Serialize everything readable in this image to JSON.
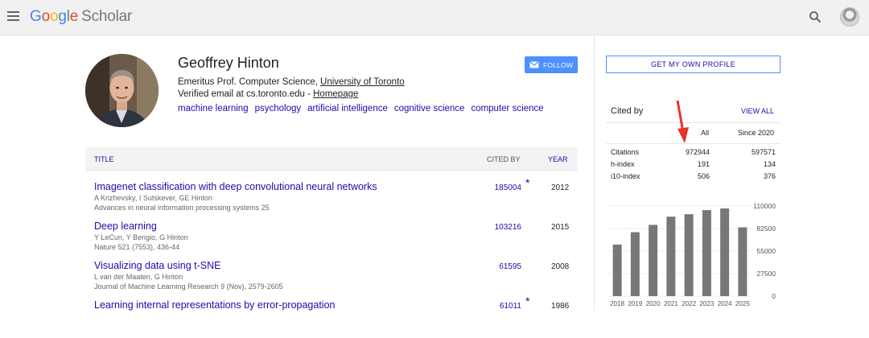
{
  "header": {
    "logo_parts": [
      "G",
      "o",
      "o",
      "g",
      "l",
      "e"
    ],
    "logo_product": "Scholar"
  },
  "profile": {
    "name": "Geoffrey Hinton",
    "affiliation_prefix": "Emeritus Prof. Computer Science, ",
    "affiliation_link": "University of Toronto",
    "email_prefix": "Verified email at cs.toronto.edu - ",
    "homepage_link": "Homepage",
    "interests": [
      "machine learning",
      "psychology",
      "artificial intelligence",
      "cognitive science",
      "computer science"
    ],
    "follow_label": "FOLLOW"
  },
  "table": {
    "col_title": "TITLE",
    "col_cited": "CITED BY",
    "col_year": "YEAR",
    "rows": [
      {
        "title": "Imagenet classification with deep convolutional neural networks",
        "authors": "A Krizhevsky, I Sutskever, GE Hinton",
        "venue": "Advances in neural information processing systems 25",
        "cited": "185004",
        "star": "*",
        "year": "2012"
      },
      {
        "title": "Deep learning",
        "authors": "Y LeCun, Y Bengio, G Hinton",
        "venue": "Nature 521 (7553), 436-44",
        "cited": "103216",
        "star": "",
        "year": "2015"
      },
      {
        "title": "Visualizing data using t-SNE",
        "authors": "L van der Maaten, G Hinton",
        "venue": "Journal of Machine Learning Research 9 (Nov), 2579-2605",
        "cited": "61595",
        "star": "",
        "year": "2008"
      },
      {
        "title": "Learning internal representations by error-propagation",
        "authors": "",
        "venue": "",
        "cited": "61011",
        "star": "*",
        "year": "1986"
      }
    ]
  },
  "sidebar": {
    "get_profile_label": "GET MY OWN PROFILE",
    "cited_by_title": "Cited by",
    "view_all_label": "VIEW ALL",
    "col_all": "All",
    "col_since": "Since 2020",
    "stats": [
      {
        "label": "Citations",
        "all": "972944",
        "since": "597571"
      },
      {
        "label": "h-index",
        "all": "191",
        "since": "134"
      },
      {
        "label": "i10-index",
        "all": "506",
        "since": "376"
      }
    ]
  },
  "annotation": {
    "color": "#e8322e",
    "icon": "red-arrow"
  },
  "colors": {
    "link": "#1a0dab",
    "follow_button": "#4d90fe",
    "bar": "#777777"
  },
  "chart_data": {
    "type": "bar",
    "categories": [
      "2018",
      "2019",
      "2020",
      "2021",
      "2022",
      "2023",
      "2024",
      "2025"
    ],
    "values": [
      63000,
      78000,
      87000,
      97000,
      100000,
      105000,
      107000,
      84000
    ],
    "yticks": [
      0,
      27500,
      55000,
      82500,
      110000
    ],
    "ylim": [
      0,
      110000
    ],
    "grid": true
  }
}
